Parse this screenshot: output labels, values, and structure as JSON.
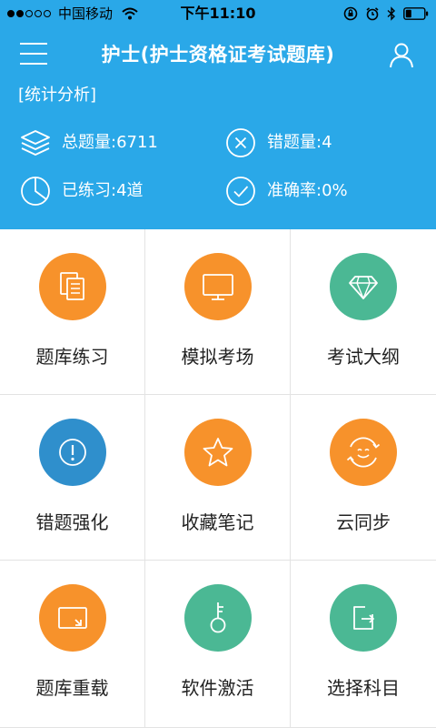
{
  "status_bar": {
    "carrier": "中国移动",
    "time": "下午11:10",
    "signal_dots_filled": 2,
    "signal_dots_total": 5
  },
  "header": {
    "title": "护士(护士资格证考试题库)",
    "section_label": "[统计分析]",
    "colors": {
      "background": "#2aa8e8",
      "text": "#ffffff"
    }
  },
  "stats": {
    "total_label": "总题量:6711",
    "wrong_label": "错题量:4",
    "done_label": "已练习:4道",
    "accuracy_label": "准确率:0%"
  },
  "menu": [
    {
      "label": "题库练习",
      "icon": "copy-icon",
      "color": "#f7922b"
    },
    {
      "label": "模拟考场",
      "icon": "monitor-icon",
      "color": "#f7922b"
    },
    {
      "label": "考试大纲",
      "icon": "diamond-icon",
      "color": "#4bb894"
    },
    {
      "label": "错题强化",
      "icon": "alert-icon",
      "color": "#2f8fcc"
    },
    {
      "label": "收藏笔记",
      "icon": "star-icon",
      "color": "#f7922b"
    },
    {
      "label": "云同步",
      "icon": "smile-icon",
      "color": "#f7922b"
    },
    {
      "label": "题库重载",
      "icon": "reload-icon",
      "color": "#f7922b"
    },
    {
      "label": "软件激活",
      "icon": "key-icon",
      "color": "#4bb894"
    },
    {
      "label": "选择科目",
      "icon": "export-icon",
      "color": "#4bb894"
    }
  ]
}
